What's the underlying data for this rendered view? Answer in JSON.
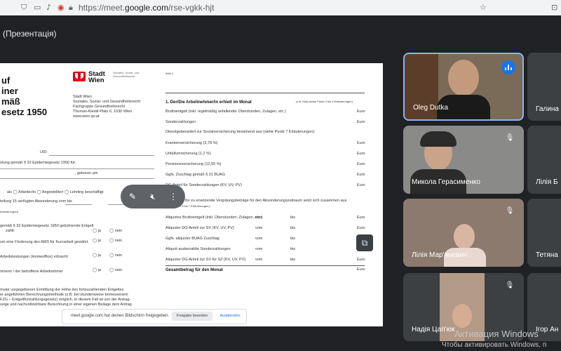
{
  "browser": {
    "url_prefix": "https://meet.",
    "url_domain": "google.com",
    "url_path": "/rse-vgkk-hjt"
  },
  "meeting": {
    "title": "(Презентація)"
  },
  "document": {
    "title_lines": [
      "uf",
      "iner",
      "mäß",
      "esetz 1950"
    ],
    "logo_text": "Stadt\nWien",
    "logo_sub": "Soziales, Sozial- und\nGesundheitsrecht",
    "address": [
      "Stadt Wien",
      "Soziales, Sozial- und Gesundheitsrecht",
      "Fachgruppe Gesundheitsrecht",
      "Thomas-Klestil-Platz 6, 1030 Wien",
      "www.wien.gv.at"
    ],
    "left_rows": [
      "UID:",
      "ütung gemäß § 32 Epidemiegesetz 1950 für:",
      ", geboren am",
      "als    ◯ Arbeiter/in    ◯ Angestellte/r    ◯ Lehrling  beschäftigt",
      "teilung 15 verfügten Absonderung vom                    bis",
      "erläuterungen)",
      "gemäß § 32 Epidemiegesetz 1950 gebührende Entgelt",
      "zahlt:",
      "um eine Förderung des AMS für Kurzarbeit gewährt",
      "Arbeitsleistungen (Homeoffice) erbracht",
      "nmerin / der betroffene Arbeitnehmer",
      "mular vorgegebenen Ermittlung der Höhe des fortzuzahlenden Entgeltes",
      "er angeführten Berechnungsmethode (z.B. bei stundenweise bemessenem",
      "FZG – Entgeltfortzahlungsgesetz) möglich. In diesem Fall ist von der Antrag-",
      "ssige und nachvollziehbare Berechnung in einer eigenen Beilage dem Antrag"
    ],
    "yes_label": "ja",
    "no_label": "nein",
    "page_label": "Seite 2",
    "section_title": "1. Der/Die Arbeitnehmer/in erhielt im Monat",
    "section_note": "(z.B. Mai) (siehe Punkt 2 bis 9 Erläuterungen)",
    "currency": "Euro",
    "right_rows": [
      "Bruttoentgelt (inkl. regelmäßig anfallender Überstunden, Zulagen, etc.)",
      "Sonderzahlungen",
      "Dienstgeberanteil zur Sozialversicherung bestehend aus (siehe Punkt 7 Erläuterungen):",
      "Krankenversicherung   (3,78 %)",
      "Unfallversicherung (1,2 %)",
      "Pensionsversicherung (12,55 %)",
      "Ggfs. Zuschlag gemäß § 21 BUAG",
      "DG-Anteil für Sonderzahlungen (KV, UV, PV)"
    ],
    "section2_title": "Der Betrag für zu ersetzende Vergütungsbeträge für den Absonderungszeitraum setzt sich zusammen aus",
    "section2_note": "(siehe Punkt 5 bis 7 Erläuterungen):",
    "right_rows2": [
      "Aliquotes Bruttoentgelt (inkl. Überstunden, Zulagen, etc.)",
      "Aliquoter DG-Anteil zur SV (KV, UV, PV)",
      "Ggfs. aliquoter BUAG Zuschlag",
      "Aliquot ausbezahlte Sonderzahlungen",
      "Aliquoter DG-Anteil zur SV für SZ (KV, UV, PV)"
    ],
    "from_label": "vom",
    "to_label": "bis",
    "total_label": "Gesamtbetrag für den Monat"
  },
  "share_bar": {
    "message": "meet.google.com hat deinen Bildschirm freigegeben.",
    "stop_label": "Freigabe beenden",
    "hide_label": "Ausblenden"
  },
  "participants": [
    {
      "name": "Oleg Dutka",
      "speaking": true
    },
    {
      "name": "Галина",
      "partial": true
    },
    {
      "name": "Микола Герасименко",
      "muted": true
    },
    {
      "name": "Лілія Б",
      "partial": true
    },
    {
      "name": "Лілія Мар'яневич",
      "muted": true
    },
    {
      "name": "Тетяна",
      "partial": true
    },
    {
      "name": "Надія Цап'юк",
      "muted": true
    },
    {
      "name": "Ігор Ан",
      "partial": true
    }
  ],
  "watermark": {
    "line1": "Активация Windows",
    "line2": "Чтобы активировать Windows, п"
  }
}
